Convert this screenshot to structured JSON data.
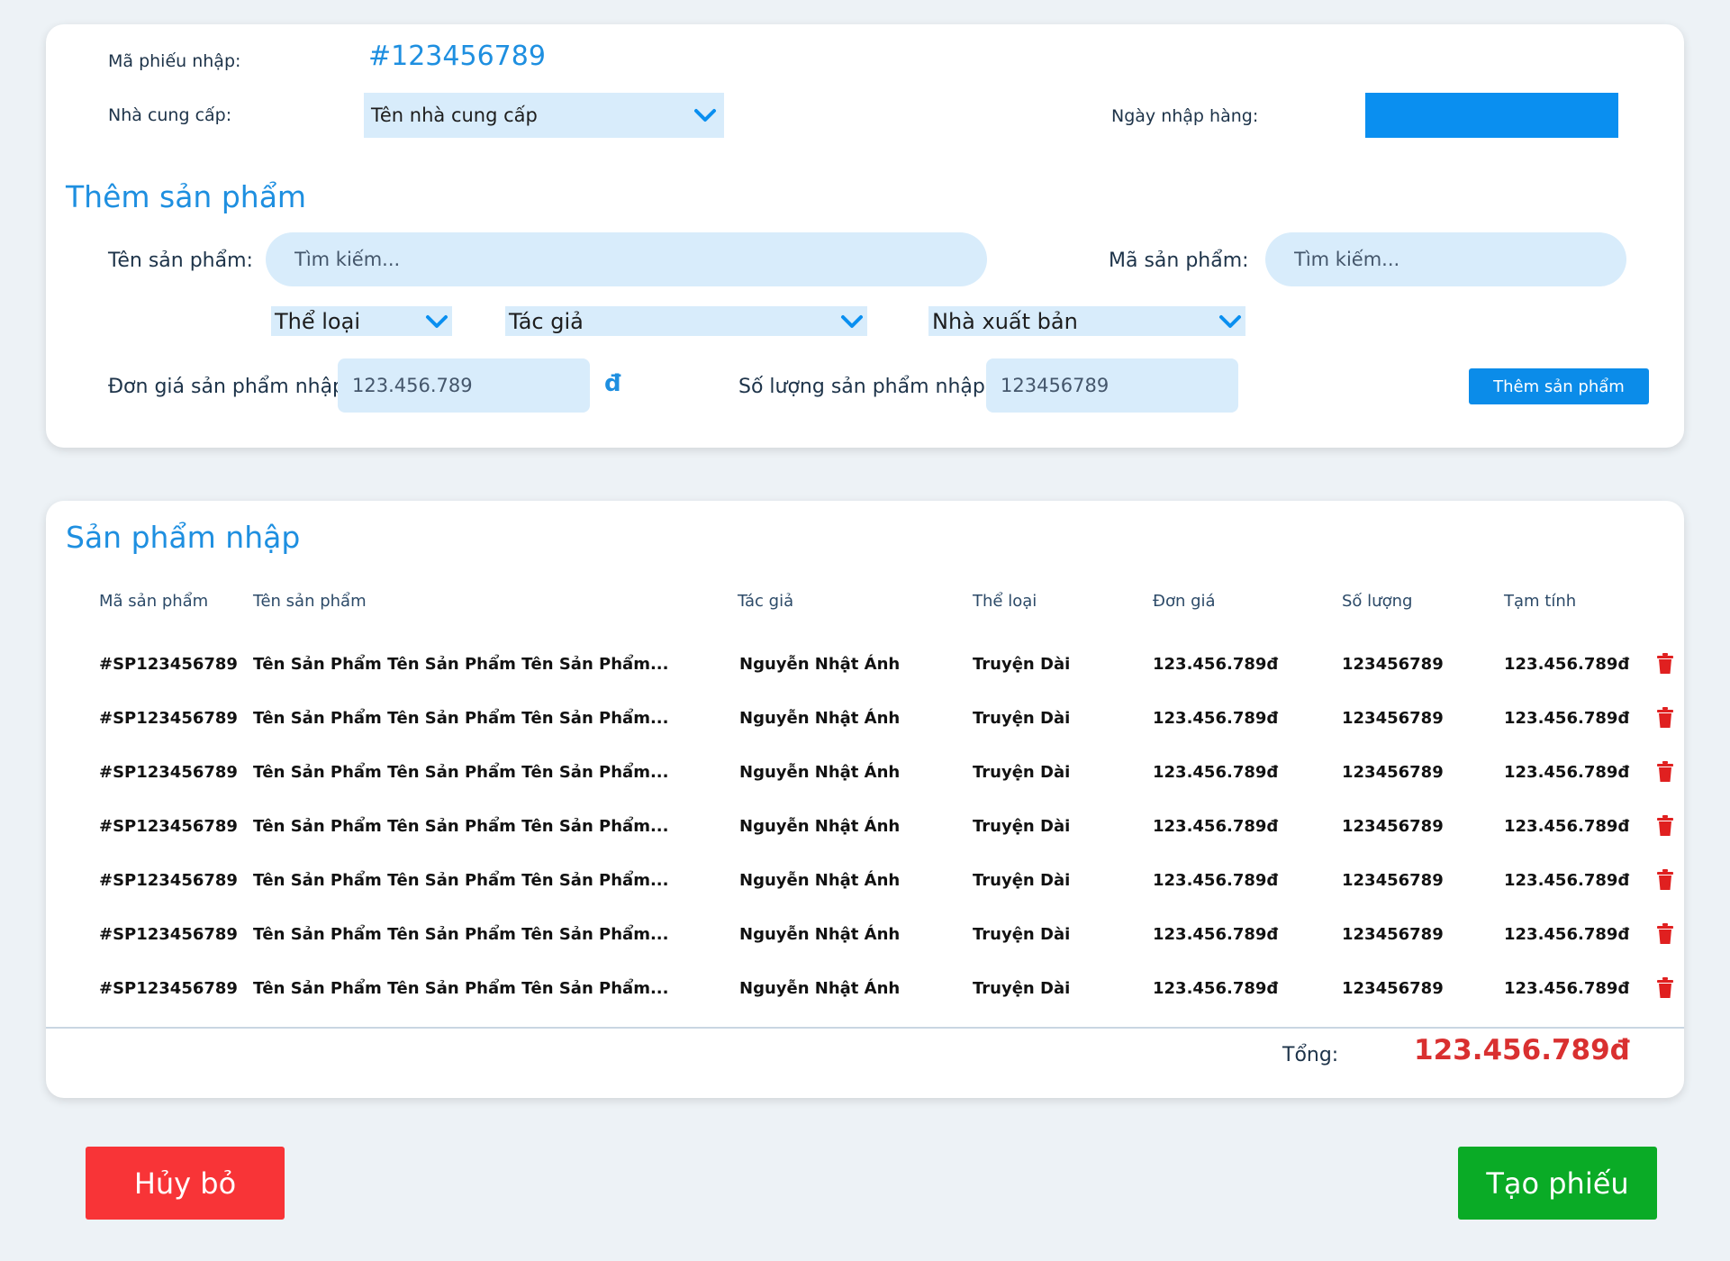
{
  "header": {
    "receipt_label": "Mã phiếu nhập:",
    "receipt_code": "#123456789",
    "supplier_label": "Nhà cung cấp:",
    "supplier_value": "Tên nhà cung cấp",
    "date_label": "Ngày nhập hàng:"
  },
  "add_product": {
    "title": "Thêm sản phẩm",
    "name_label": "Tên sản phẩm:",
    "name_placeholder": "Tìm kiếm...",
    "code_label": "Mã sản phẩm:",
    "code_placeholder": "Tìm kiếm...",
    "category_value": "Thể loại",
    "author_value": "Tác giả",
    "publisher_value": "Nhà xuất bản",
    "price_label": "Đơn giá sản phẩm nhập:",
    "price_placeholder": "123.456.789",
    "currency_symbol": "đ",
    "qty_label": "Số lượng sản phẩm nhập:",
    "qty_placeholder": "123456789",
    "add_button": "Thêm sản phẩm"
  },
  "imported": {
    "title": "Sản phẩm nhập",
    "columns": [
      "Mã sản phẩm",
      "Tên sản phẩm",
      "Tác giả",
      "Thể loại",
      "Đơn giá",
      "Số lượng",
      "Tạm tính"
    ],
    "rows": [
      [
        "#SP123456789",
        "Tên Sản Phẩm Tên Sản Phẩm Tên Sản Phẩm...",
        "Nguyễn Nhật Ánh",
        "Truyện Dài",
        "123.456.789đ",
        "123456789",
        "123.456.789đ"
      ],
      [
        "#SP123456789",
        "Tên Sản Phẩm Tên Sản Phẩm Tên Sản Phẩm...",
        "Nguyễn Nhật Ánh",
        "Truyện Dài",
        "123.456.789đ",
        "123456789",
        "123.456.789đ"
      ],
      [
        "#SP123456789",
        "Tên Sản Phẩm Tên Sản Phẩm Tên Sản Phẩm...",
        "Nguyễn Nhật Ánh",
        "Truyện Dài",
        "123.456.789đ",
        "123456789",
        "123.456.789đ"
      ],
      [
        "#SP123456789",
        "Tên Sản Phẩm Tên Sản Phẩm Tên Sản Phẩm...",
        "Nguyễn Nhật Ánh",
        "Truyện Dài",
        "123.456.789đ",
        "123456789",
        "123.456.789đ"
      ],
      [
        "#SP123456789",
        "Tên Sản Phẩm Tên Sản Phẩm Tên Sản Phẩm...",
        "Nguyễn Nhật Ánh",
        "Truyện Dài",
        "123.456.789đ",
        "123456789",
        "123.456.789đ"
      ],
      [
        "#SP123456789",
        "Tên Sản Phẩm Tên Sản Phẩm Tên Sản Phẩm...",
        "Nguyễn Nhật Ánh",
        "Truyện Dài",
        "123.456.789đ",
        "123456789",
        "123.456.789đ"
      ],
      [
        "#SP123456789",
        "Tên Sản Phẩm Tên Sản Phẩm Tên Sản Phẩm...",
        "Nguyễn Nhật Ánh",
        "Truyện Dài",
        "123.456.789đ",
        "123456789",
        "123.456.789đ"
      ]
    ],
    "total_label": "Tổng:",
    "total_value": "123.456.789đ"
  },
  "actions": {
    "cancel": "Hủy bỏ",
    "create": "Tạo phiếu"
  },
  "colors": {
    "accent": "#1e8fe0",
    "input_bg": "#d8ecfb",
    "danger": "#f83437",
    "success": "#0aab26",
    "total": "#d93030"
  },
  "icons": {
    "dropdown": "chevron-down-icon",
    "delete": "trash-icon"
  }
}
